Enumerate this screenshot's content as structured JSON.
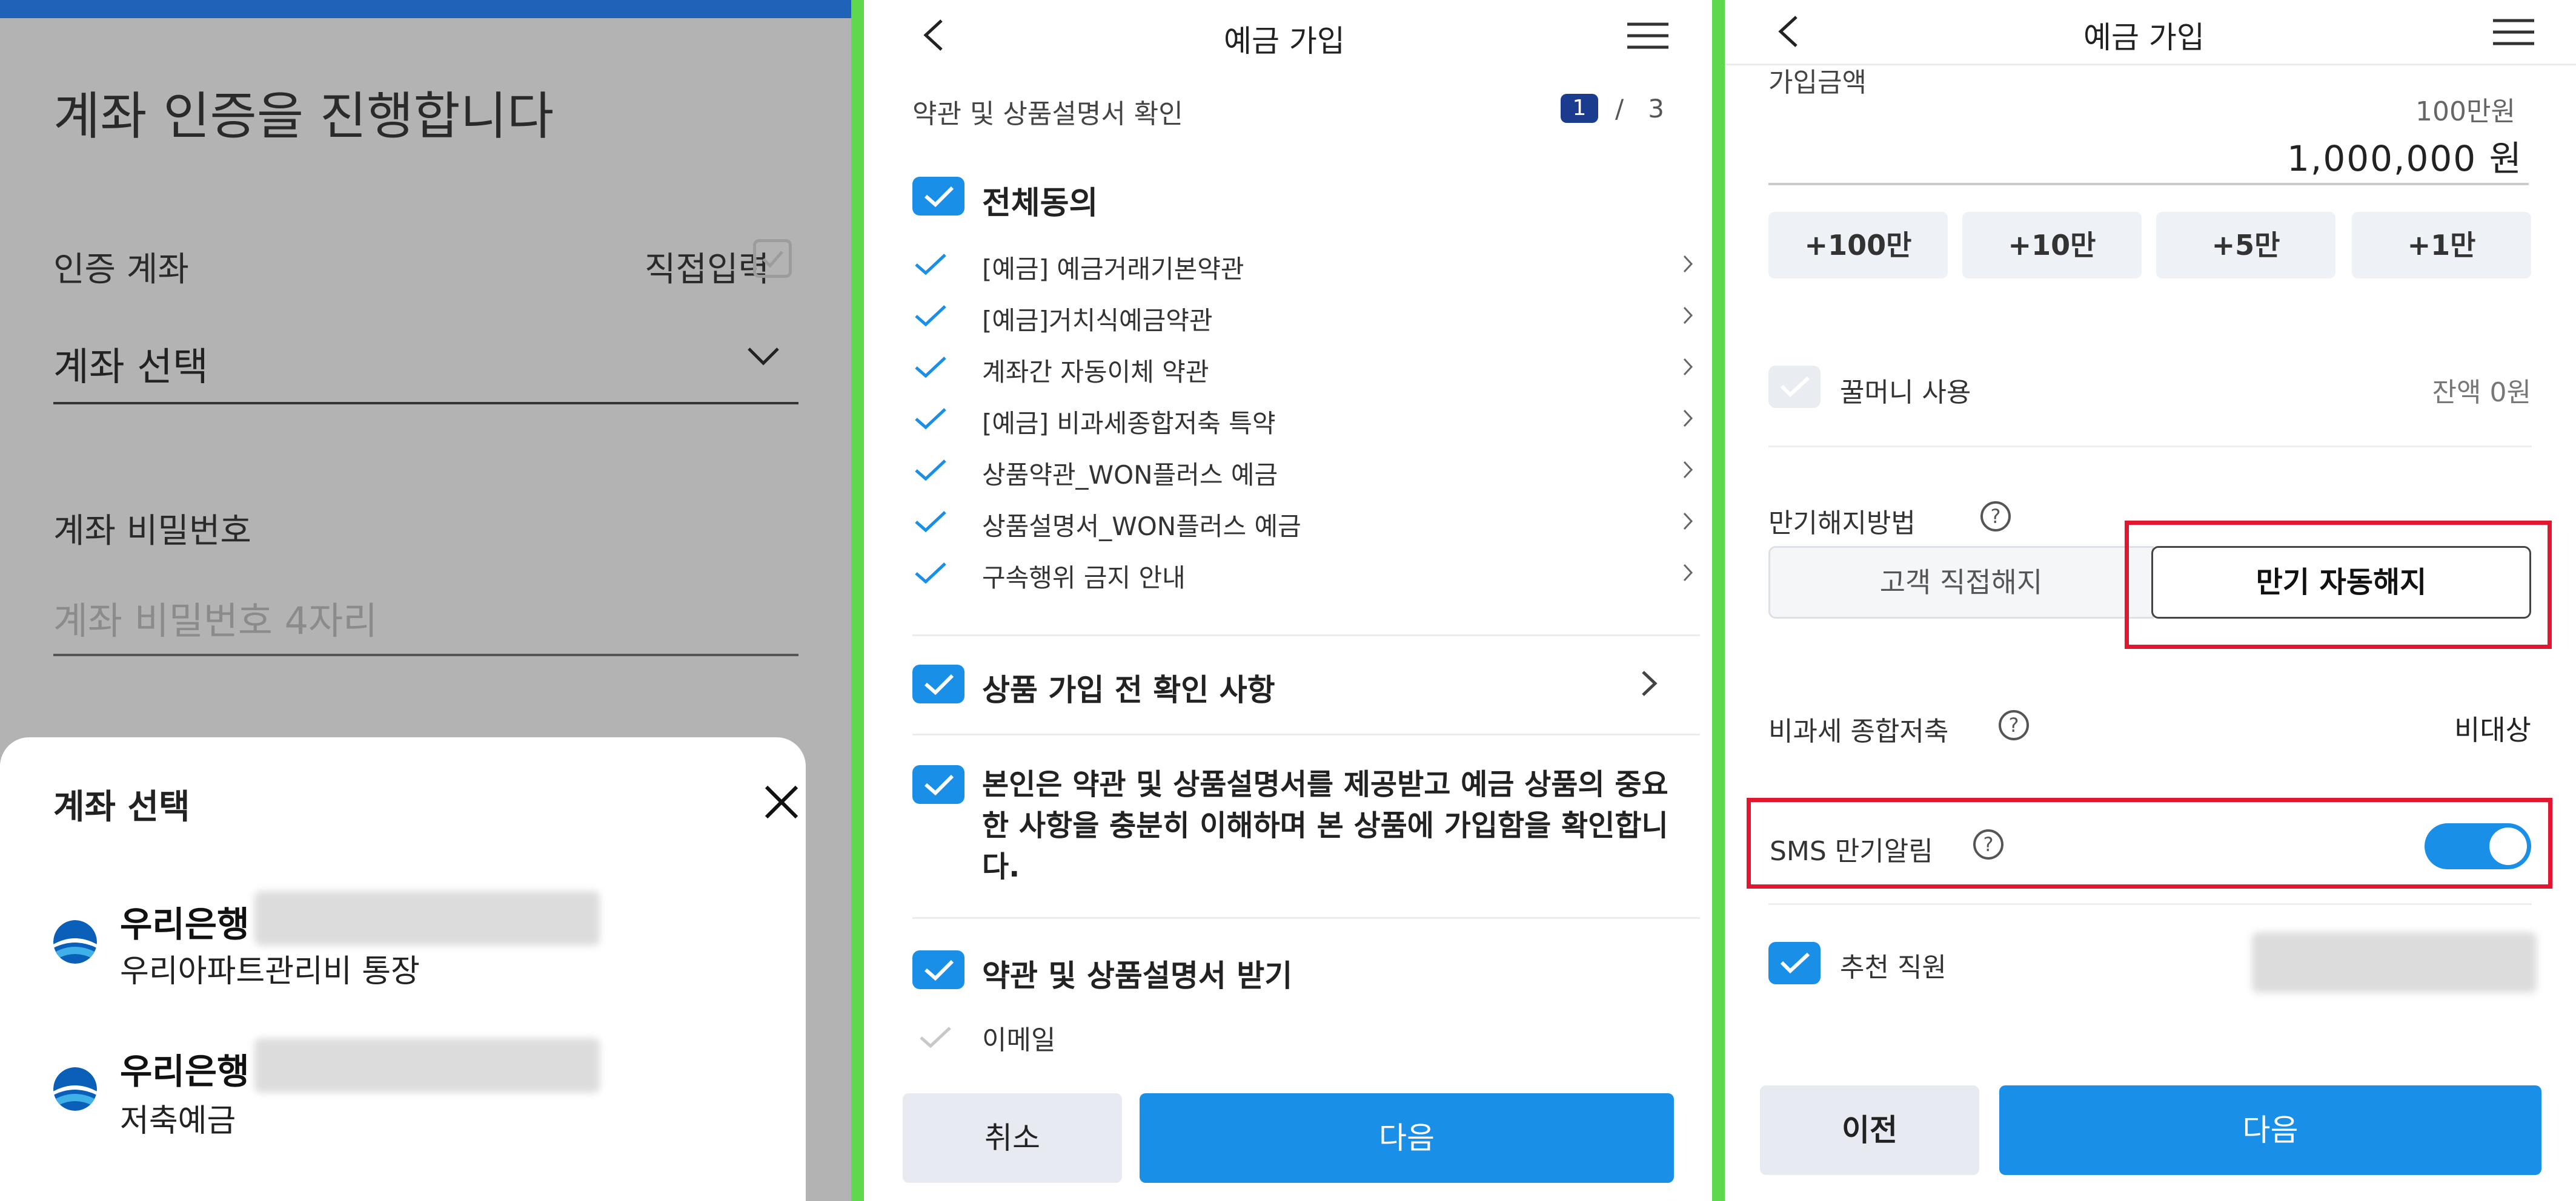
{
  "colors": {
    "brand_blue": "#1a8fe8",
    "highlight_red": "#e0172e",
    "divider_green": "#5ed94d",
    "step_badge": "#1b3b8f"
  },
  "panel1": {
    "title": "계좌 인증을 진행합니다",
    "account_label": "인증 계좌",
    "direct_input_label": "직접입력",
    "account_select": "계좌 선택",
    "password_label": "계좌 비밀번호",
    "password_placeholder": "계좌 비밀번호 4자리",
    "sheet": {
      "title": "계좌 선택",
      "accounts": [
        {
          "bank": "우리은행",
          "name": "우리아파트관리비 통장"
        },
        {
          "bank": "우리은행",
          "name": "저축예금"
        }
      ]
    }
  },
  "panel2": {
    "header_title": "예금 가입",
    "subtitle": "약관 및 상품설명서 확인",
    "step_current": "1",
    "step_sep": "/",
    "step_total": "3",
    "agree_all": "전체동의",
    "terms": [
      "[예금] 예금거래기본약관",
      "[예금]거치식예금약관",
      "계좌간 자동이체 약관",
      "[예금] 비과세종합저축 특약",
      "상품약관_WON플러스 예금",
      "상품설명서_WON플러스 예금",
      "구속행위 금지 안내"
    ],
    "pre_check": "상품 가입 전 확인 사항",
    "confirm_text": "본인은 약관 및 상품설명서를 제공받고 예금 상품의 중요한 사항을 충분히 이해하며 본 상품에 가입함을 확인합니다.",
    "receive_docs": "약관 및 상품설명서 받기",
    "email": "이메일",
    "cancel_button": "취소",
    "next_button": "다음"
  },
  "panel3": {
    "header_title": "예금 가입",
    "amount_label": "가입금액",
    "amount_unit": "100만원",
    "amount_value": "1,000,000 원",
    "quick_buttons": [
      "+100만",
      "+10만",
      "+5만",
      "+1만"
    ],
    "honey_money_label": "꿀머니 사용",
    "balance_text": "잔액 0원",
    "maturity_label": "만기해지방법",
    "maturity_options": [
      "고객 직접해지",
      "만기 자동해지"
    ],
    "maturity_selected": "만기 자동해지",
    "tax_free_label": "비과세 종합저축",
    "tax_free_value": "비대상",
    "sms_label": "SMS 만기알림",
    "sms_enabled": true,
    "recommender_label": "추천 직원",
    "prev_button": "이전",
    "next_button": "다음"
  }
}
